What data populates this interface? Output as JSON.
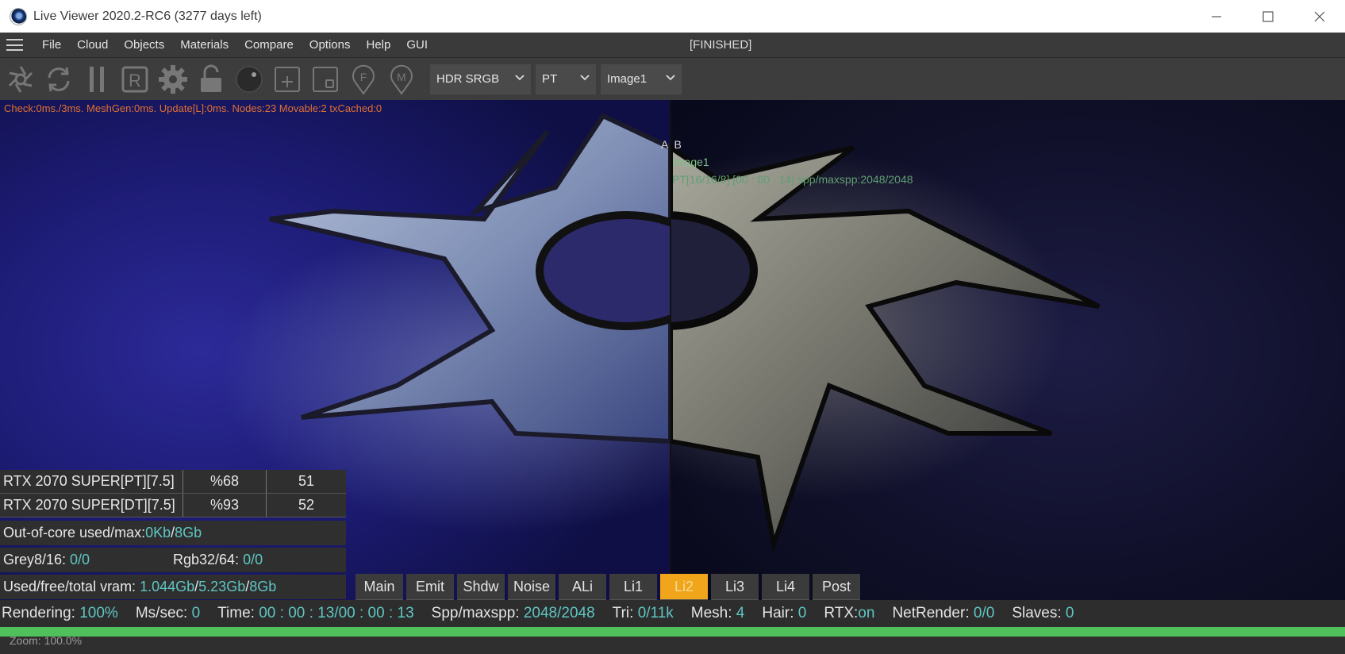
{
  "window": {
    "title": "Live Viewer 2020.2-RC6 (3277 days left)",
    "controls": [
      "minimize-icon",
      "maximize-icon",
      "close-icon"
    ]
  },
  "menubar": {
    "items": [
      "File",
      "Cloud",
      "Objects",
      "Materials",
      "Compare",
      "Options",
      "Help",
      "GUI"
    ],
    "status": "[FINISHED]"
  },
  "toolbar": {
    "icons": [
      "aperture-icon",
      "refresh-icon",
      "pause-icon",
      "r-box-icon",
      "gear-icon",
      "unlock-icon",
      "sphere-icon",
      "add-box-icon",
      "small-box-icon",
      "f-pin-icon",
      "m-pin-icon"
    ],
    "dropdowns": {
      "color_space": "HDR SRGB",
      "kernel": "PT",
      "image": "Image1"
    }
  },
  "viewport": {
    "debug": "Check:0ms./3ms. MeshGen:0ms. Update[L]:0ms. Nodes:23 Movable:2 txCached:0",
    "ab_label": "A  B",
    "compare_image": "Image1",
    "compare_info": "PT[16/16/8] [00 : 00 : 14] spp/maxspp:2048/2048",
    "accent_colors": {
      "debug": "#e07030",
      "overlay": "#7fbf8a",
      "value": "#5ec6c2",
      "active_tab": "#f0a51a",
      "progress": "#4fc05a"
    }
  },
  "stats": {
    "gpus": [
      {
        "name": "RTX 2070 SUPER[PT][7.5]",
        "pct": "%68",
        "temp": "51"
      },
      {
        "name": "RTX 2070 SUPER[DT][7.5]",
        "pct": "%93",
        "temp": "52"
      }
    ],
    "out_of_core": {
      "label": "Out-of-core used/max:",
      "used": "0Kb",
      "sep": "/",
      "max": "8Gb"
    },
    "grey": {
      "label": "Grey8/16: ",
      "value": "0/0"
    },
    "rgb": {
      "label": "Rgb32/64: ",
      "value": "0/0"
    },
    "vram": {
      "label": "Used/free/total vram: ",
      "used": "1.044Gb",
      "free": "5.23Gb",
      "total": "8Gb",
      "sep": "/"
    }
  },
  "passes": {
    "tabs": [
      "Main",
      "Emit",
      "Shdw",
      "Noise",
      "ALi",
      "Li1",
      "Li2",
      "Li3",
      "Li4",
      "Post"
    ],
    "active": "Li2"
  },
  "statusbar": {
    "rendering_label": "Rendering: ",
    "rendering": "100%",
    "ms_label": "Ms/sec: ",
    "ms": "0",
    "time_label": "Time: ",
    "time": "00 : 00 : 13/00 : 00 : 13",
    "spp_label": "Spp/maxspp: ",
    "spp": "2048/2048",
    "tri_label": "Tri: ",
    "tri": "0/11k",
    "mesh_label": "Mesh: ",
    "mesh": "4",
    "hair_label": "Hair: ",
    "hair": "0",
    "rtx_label": "RTX:",
    "rtx": "on",
    "netrender_label": "NetRender: ",
    "netrender": "0/0",
    "slaves_label": "Slaves: ",
    "slaves": "0",
    "progress_fraction": 1.0
  },
  "zoom": {
    "label": "Zoom: 100.0%"
  }
}
